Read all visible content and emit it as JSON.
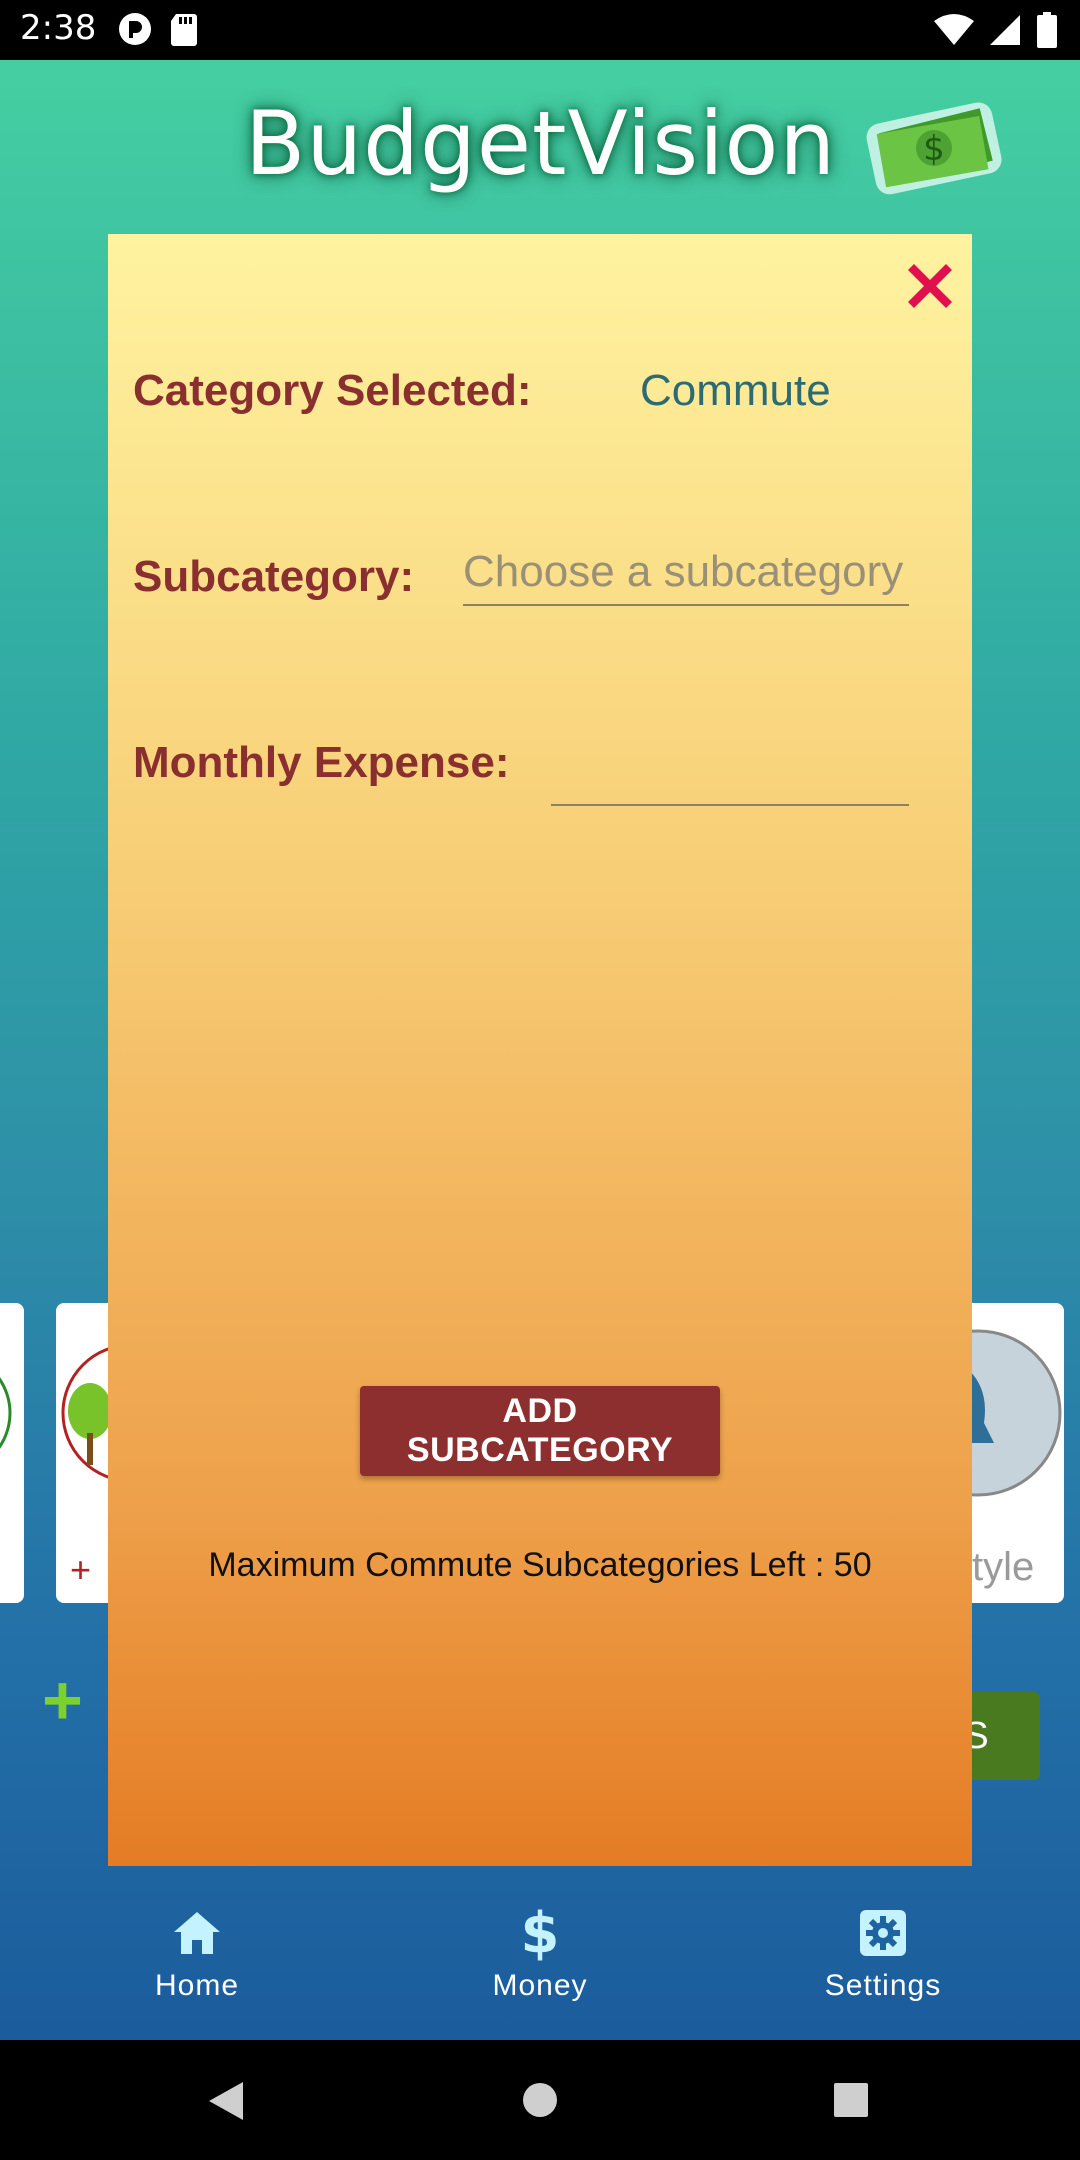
{
  "status_bar": {
    "time": "2:38"
  },
  "app": {
    "title": "BudgetVision"
  },
  "background": {
    "partial_card_label": "style",
    "partial_button_label": "ES"
  },
  "modal": {
    "category_label": "Category Selected:",
    "category_value": "Commute",
    "subcategory_label": "Subcategory:",
    "subcategory_placeholder": "Choose a subcategory",
    "monthly_expense_label": "Monthly Expense:",
    "monthly_expense_value": "",
    "add_button_label": "ADD SUBCATEGORY",
    "max_text": "Maximum Commute Subcategories Left : 50"
  },
  "nav": {
    "items": [
      {
        "label": "Home",
        "icon": "home-icon"
      },
      {
        "label": "Money",
        "icon": "dollar-icon"
      },
      {
        "label": "Settings",
        "icon": "gear-icon"
      }
    ]
  },
  "colors": {
    "label": "#8a2f2f",
    "value": "#2c6b73",
    "button": "#8e2f2f",
    "close": "#e0104f"
  }
}
